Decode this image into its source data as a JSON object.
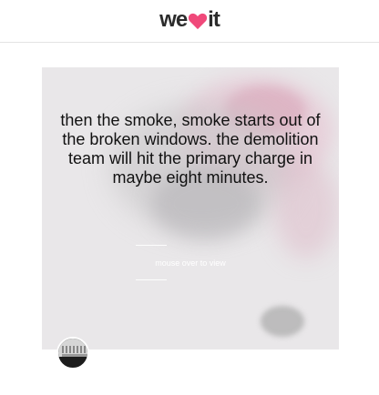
{
  "brand": {
    "logo_left": "we",
    "logo_right": "it",
    "heart_color": "#f0497a"
  },
  "post": {
    "quote": "then the smoke, smoke starts out of the broken windows. the demolition team will hit the primary charge in maybe eight minutes.",
    "hint": "mouse over to view"
  },
  "user": {
    "avatar_icon": "user-avatar"
  }
}
